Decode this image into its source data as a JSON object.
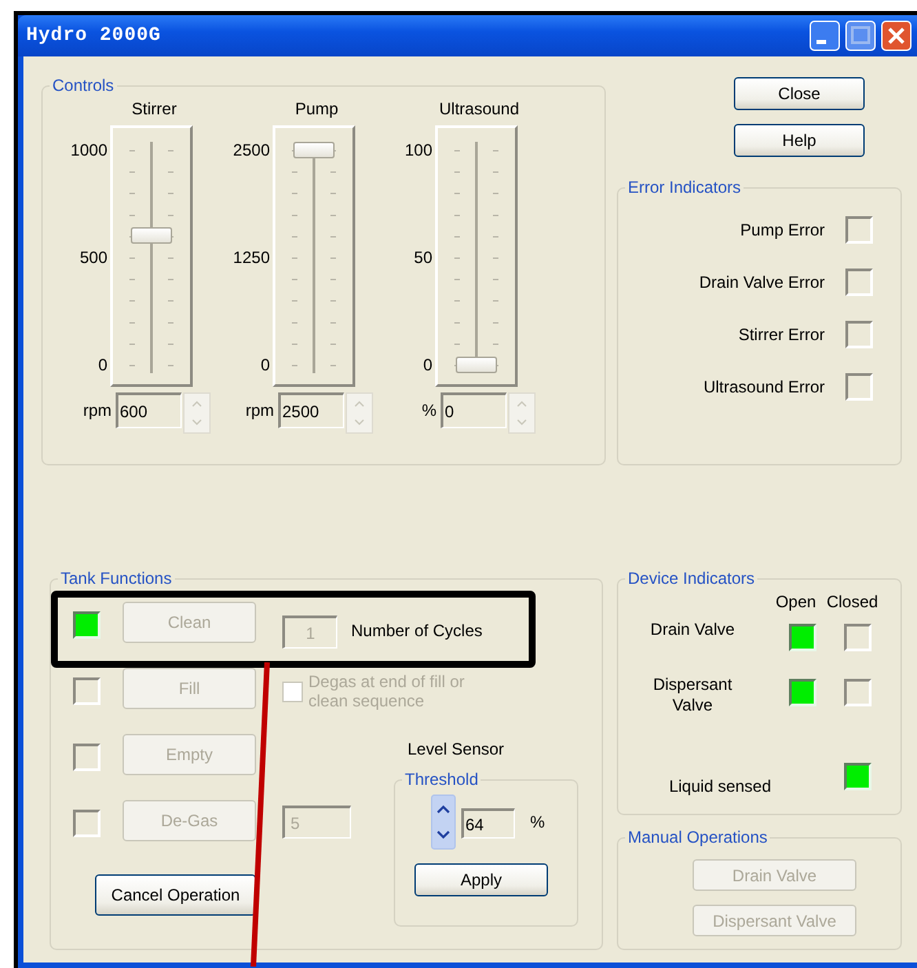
{
  "window": {
    "title": "Hydro 2000G"
  },
  "controls": {
    "title": "Controls",
    "sliders": [
      {
        "label": "Stirrer",
        "ticks": [
          "1000",
          "500",
          "0"
        ],
        "unit": "rpm",
        "value": "600",
        "level": 0.6
      },
      {
        "label": "Pump",
        "ticks": [
          "2500",
          "1250",
          "0"
        ],
        "unit": "rpm",
        "value": "2500",
        "level": 1
      },
      {
        "label": "Ultrasound",
        "ticks": [
          "100",
          "50",
          "0"
        ],
        "unit": "%",
        "value": "0",
        "level": 0
      }
    ]
  },
  "buttons": [
    "Close",
    "Help"
  ],
  "error_indicators": {
    "title": "Error Indicators",
    "items": [
      {
        "label": "Pump Error",
        "on": false
      },
      {
        "label": "Drain Valve Error",
        "on": false
      },
      {
        "label": "Stirrer Error",
        "on": false
      },
      {
        "label": "Ultrasound Error",
        "on": false
      }
    ]
  },
  "tank_functions": {
    "title": "Tank Functions",
    "rows": [
      {
        "label": "Clean",
        "active": true,
        "disabled": true,
        "highlighted": true,
        "count": "1",
        "count_label": "Number of Cycles"
      },
      {
        "label": "Fill",
        "active": false,
        "disabled": true,
        "highlighted": false,
        "option": {
          "label": "Degas at end of fill or clean sequence",
          "checked": false,
          "disabled": true
        }
      },
      {
        "label": "Empty",
        "active": false,
        "disabled": true,
        "highlighted": false
      },
      {
        "label": "De-Gas",
        "active": false,
        "disabled": true,
        "highlighted": false,
        "count": "5"
      }
    ],
    "cancel_button": "Cancel Operation",
    "level_sensor": {
      "label": "Level Sensor",
      "group_title": "Threshold",
      "value": "64",
      "unit": "%",
      "apply_button": "Apply"
    }
  },
  "device_indicators": {
    "title": "Device Indicators",
    "columns": [
      "Open",
      "Closed"
    ],
    "rows": [
      {
        "label": "Drain Valve",
        "open": true,
        "closed": false
      },
      {
        "label": "Dispersant Valve",
        "open": true,
        "closed": false
      }
    ],
    "liquid_sensed": {
      "label": "Liquid sensed",
      "on": true
    }
  },
  "manual_operations": {
    "title": "Manual Operations",
    "buttons": [
      {
        "label": "Drain Valve",
        "disabled": true
      },
      {
        "label": "Dispersant Valve",
        "disabled": true
      }
    ]
  }
}
